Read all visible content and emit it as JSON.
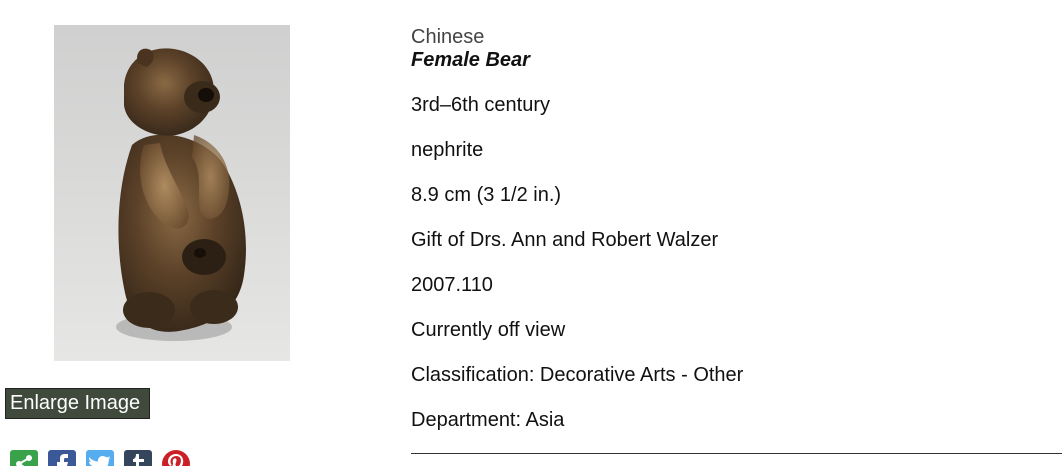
{
  "artwork": {
    "enlarge_label": "Enlarge Image"
  },
  "share": {
    "icons": [
      "share-icon",
      "facebook-icon",
      "twitter-icon",
      "tumblr-icon",
      "pinterest-icon"
    ]
  },
  "details": {
    "culture": "Chinese",
    "title": "Female Bear",
    "date": "3rd–6th century",
    "medium": "nephrite",
    "dimensions": "8.9 cm (3 1/2 in.)",
    "credit_line": "Gift of Drs. Ann and Robert Walzer",
    "accession_number": "2007.110",
    "location": "Currently off view",
    "classification": "Classification: Decorative Arts - Other",
    "department": "Department: Asia"
  },
  "colors": {
    "enlarge_bg": "#3f4a3c",
    "share_generic": "#3aa24a",
    "facebook": "#3b5998",
    "twitter": "#55acee",
    "tumblr": "#35465c",
    "pinterest": "#cb2027"
  }
}
